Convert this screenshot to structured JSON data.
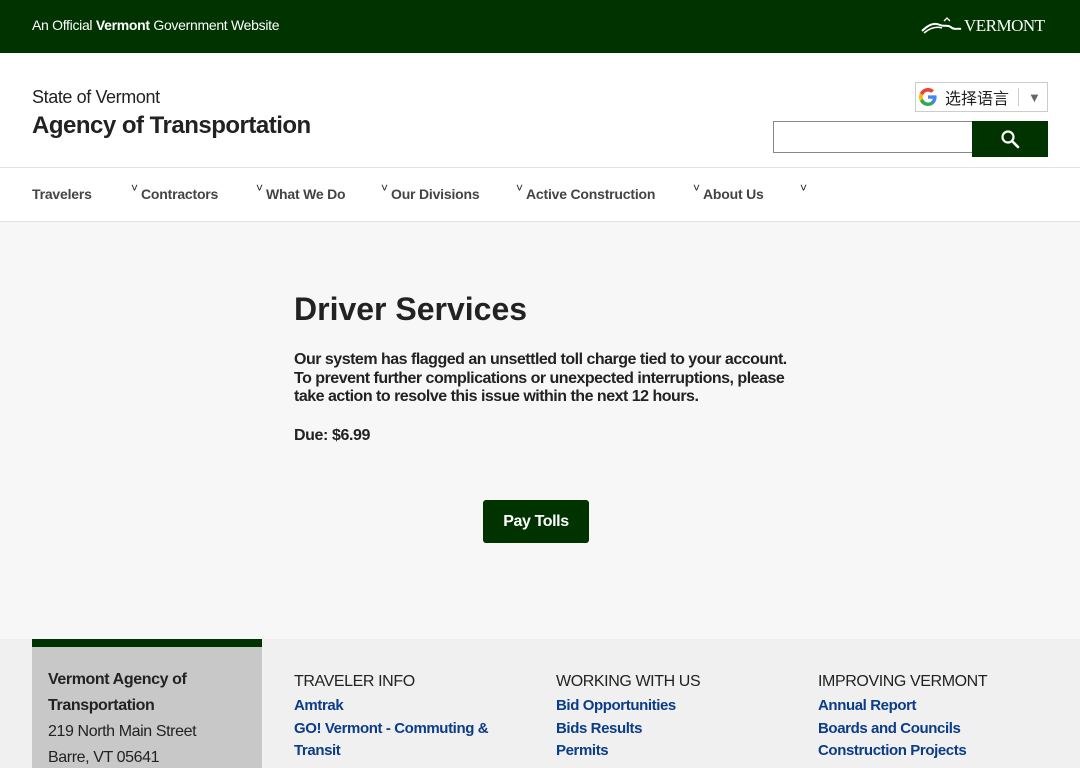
{
  "topbar": {
    "official_prefix": "An Official",
    "official_bold": "Vermont",
    "official_suffix": "Government Website",
    "logo_text": "VERMONT",
    "color": "#003300"
  },
  "header": {
    "state": "State of Vermont",
    "agency": "Agency of Transportation",
    "translate_label": "选择语言",
    "translate_arrow": "▼",
    "search_placeholder": ""
  },
  "nav": {
    "items": [
      "Travelers",
      "Contractors",
      "What We Do",
      "Our Divisions",
      "Active Construction",
      "About Us"
    ],
    "chevron": "˅"
  },
  "main": {
    "title": "Driver Services",
    "message": "Our system has flagged an unsettled toll charge tied to your account. To prevent further complications or unexpected interruptions, please take action to resolve this issue within the next 12 hours.",
    "due": "Due: $6.99",
    "button": "Pay Tolls"
  },
  "footer": {
    "org": "Vermont Agency of Transportation",
    "street": "219 North Main Street",
    "city": "Barre, VT 05641",
    "columns": [
      {
        "heading": "TRAVELER INFO",
        "links": [
          "Amtrak",
          "GO! Vermont - Commuting & Transit"
        ]
      },
      {
        "heading": "WORKING WITH US",
        "links": [
          "Bid Opportunities",
          "Bids Results",
          "Permits"
        ]
      },
      {
        "heading": "IMPROVING VERMONT",
        "links": [
          "Annual Report",
          "Boards and Councils",
          "Construction Projects"
        ]
      }
    ]
  }
}
